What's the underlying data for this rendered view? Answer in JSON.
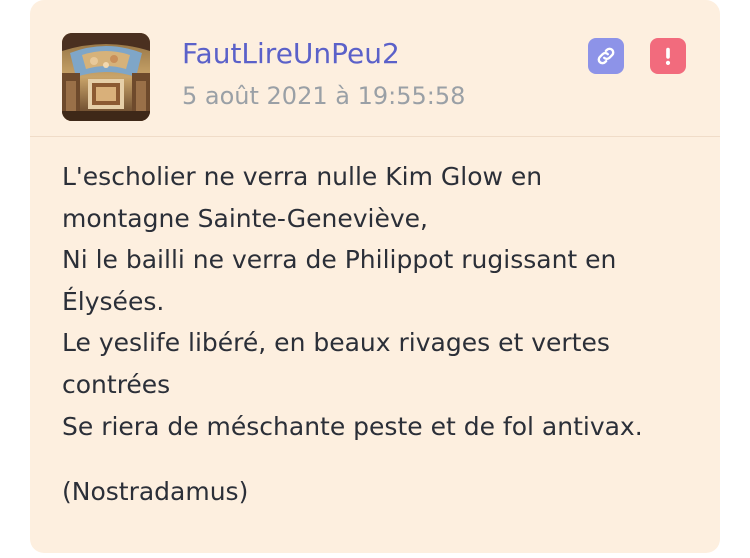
{
  "post": {
    "username": "FautLireUnPeu2",
    "timestamp": "5 août 2021 à 19:55:58",
    "avatar_icon": "fresco-painting-avatar",
    "actions": {
      "link_icon": "link-icon",
      "report_icon": "exclamation-icon"
    },
    "lines": [
      "L'escholier ne verra nulle Kim Glow en",
      "montagne Sainte-Geneviève,",
      "Ni le bailli ne verra de Philippot rugissant en",
      "Élysées.",
      "Le yeslife libéré, en beaux rivages et vertes",
      "contrées",
      "Se riera de méschante peste et de fol antivax."
    ],
    "signature": "(Nostradamus)"
  },
  "colors": {
    "card_background": "#fdefdf",
    "username": "#5b61c9",
    "timestamp": "#9aa0a6",
    "link_button": "#8d93e8",
    "report_button": "#f26b7d"
  }
}
